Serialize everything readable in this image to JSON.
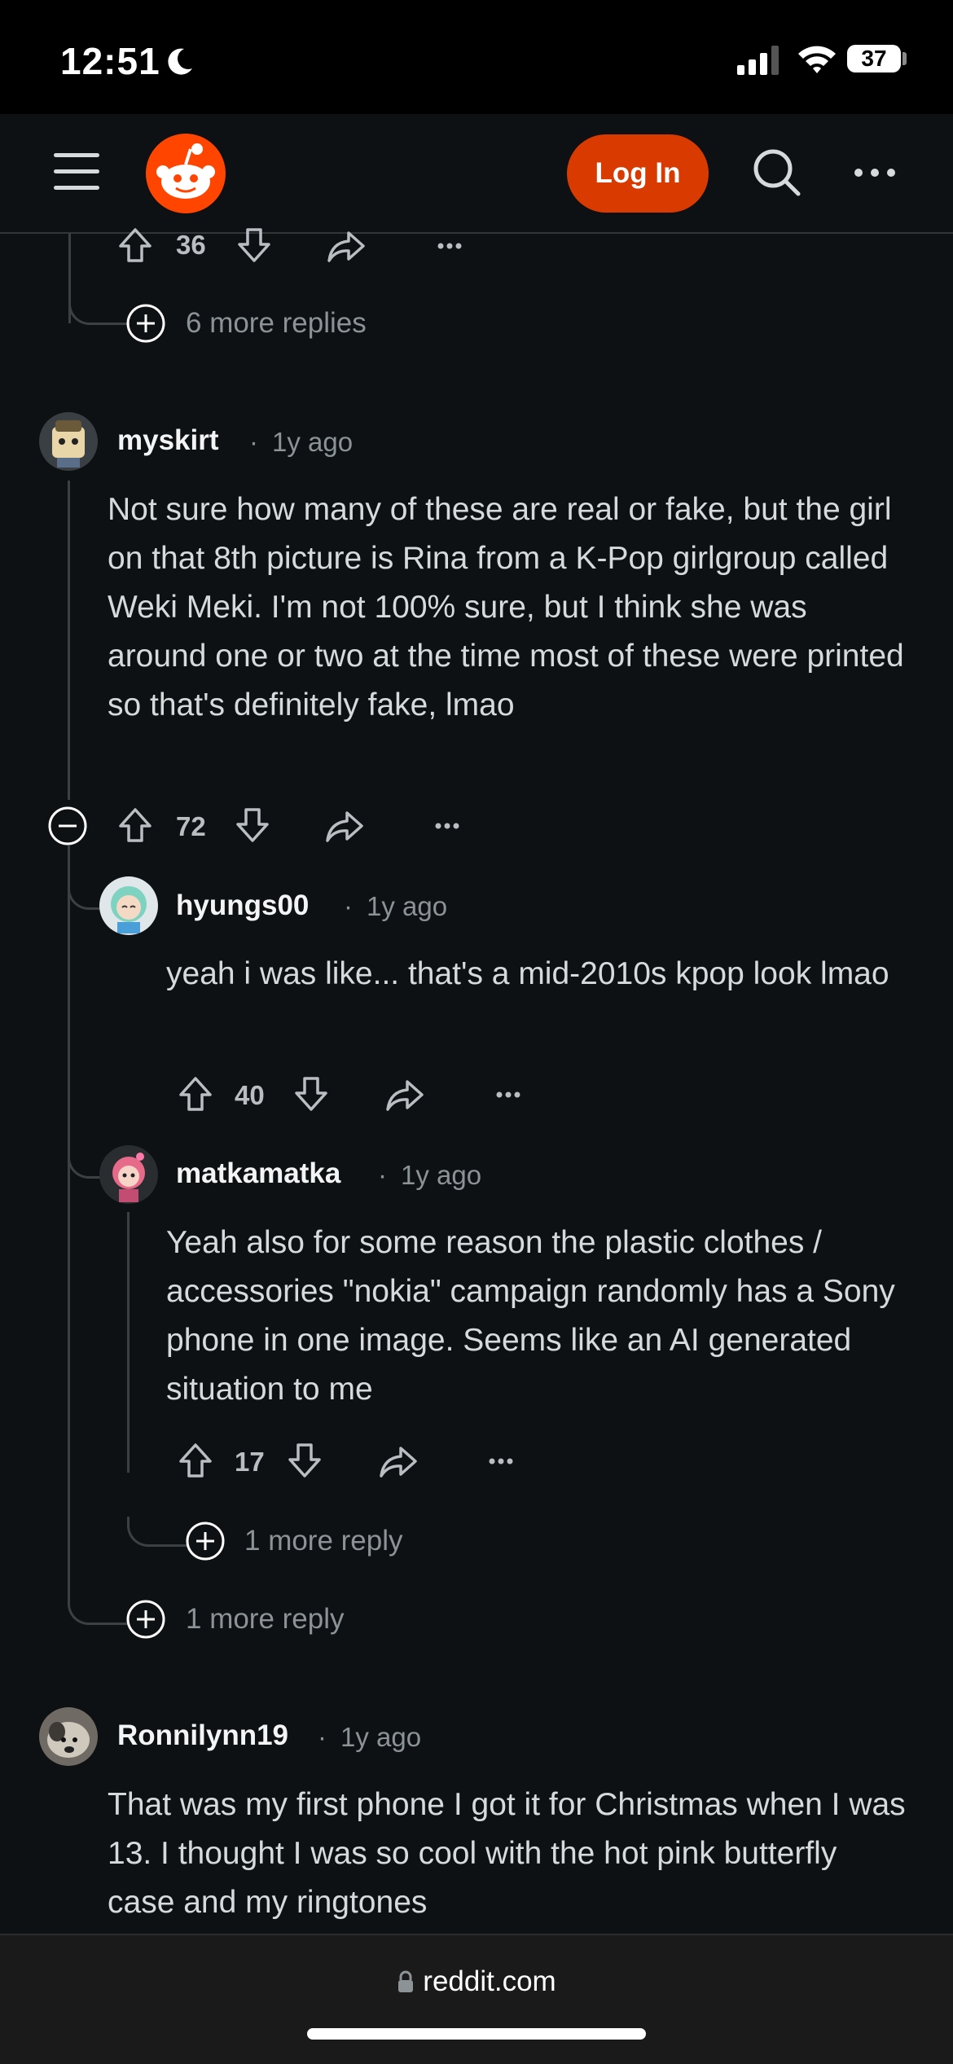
{
  "status_bar": {
    "time": "12:51",
    "battery": "37",
    "moon_icon": "moon-icon",
    "signal_icon": "cellular-signal-icon",
    "wifi_icon": "wifi-icon"
  },
  "header": {
    "menu_icon": "hamburger-menu-icon",
    "logo_icon": "reddit-logo-icon",
    "login_label": "Log In",
    "search_icon": "search-icon",
    "more_icon": "more-options-icon",
    "accent_color": "#d93a00"
  },
  "comments": {
    "top_partial": {
      "votes": "36",
      "more_replies": "6 more replies"
    },
    "c1": {
      "username": "myskirt",
      "age": "1y ago",
      "body": "Not sure how many of these are real or fake, but the girl on that 8th picture is Rina from a K-Pop girlgroup called Weki Meki. I'm not 100% sure, but I think she was around one or two at the time most of these were printed so that's definitely fake, lmao",
      "votes": "72",
      "more_replies": "1 more reply"
    },
    "c2": {
      "username": "hyungs00",
      "age": "1y ago",
      "body": "yeah i was like... that's a mid-2010s kpop look lmao",
      "votes": "40"
    },
    "c3": {
      "username": "matkamatka",
      "age": "1y ago",
      "body": "Yeah also for some reason the plastic clothes / accessories \"nokia\" campaign randomly has a Sony phone in one image. Seems like an AI generated situation to me",
      "votes": "17",
      "more_replies": "1 more reply"
    },
    "c4": {
      "username": "Ronnilynn19",
      "age": "1y ago",
      "body": "That was my first phone I got it for Christmas when I was 13. I thought I was so cool with the hot pink butterfly case and my ringtones"
    }
  },
  "bottom_bar": {
    "url": "reddit.com",
    "lock_icon": "lock-icon"
  }
}
